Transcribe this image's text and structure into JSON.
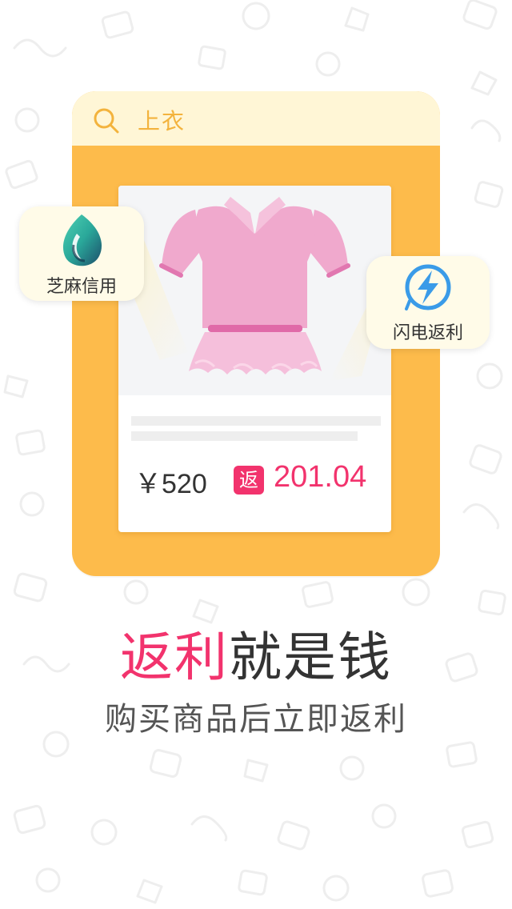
{
  "search": {
    "query": "上衣"
  },
  "product": {
    "price": "￥520",
    "rebate_badge": "返",
    "rebate_amount": "201.04"
  },
  "badges": {
    "left": {
      "label": "芝麻信用",
      "icon": "sesame-credit-icon"
    },
    "right": {
      "label": "闪电返利",
      "icon": "lightning-icon"
    }
  },
  "headline": {
    "accent": "返利",
    "rest": "就是钱"
  },
  "subline": "购买商品后立即返利",
  "colors": {
    "accent": "#f2336d",
    "card": "#fdbb4b",
    "search_bar": "#fff6d6",
    "lightning": "#3a9be8"
  }
}
